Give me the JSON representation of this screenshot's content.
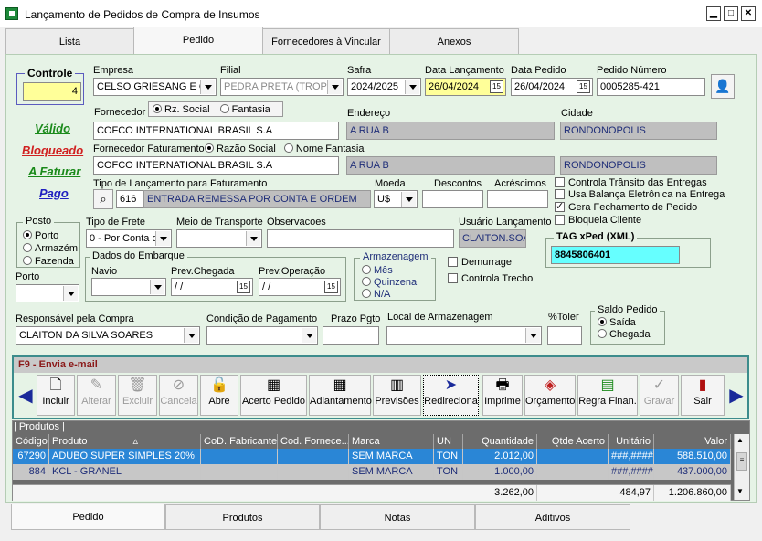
{
  "window": {
    "title": "Lançamento de Pedidos de Compra de Insumos",
    "min": "▁",
    "max": "□",
    "close": "✕"
  },
  "tabs": [
    "Lista",
    "Pedido",
    "Fornecedores à Vincular",
    "Anexos"
  ],
  "controle": {
    "legend": "Controle",
    "value": "4"
  },
  "empresa": {
    "label": "Empresa",
    "value": "CELSO GRIESANG E OU"
  },
  "filial": {
    "label": "Filial",
    "value": "PEDRA PRETA (TROPIC"
  },
  "safra": {
    "label": "Safra",
    "value": "2024/2025"
  },
  "data_lancamento": {
    "label": "Data Lançamento",
    "value": "26/04/2024"
  },
  "data_pedido": {
    "label": "Data Pedido",
    "value": "26/04/2024"
  },
  "pedido_numero": {
    "label": "Pedido Número",
    "value": "0005285-421"
  },
  "status": {
    "valido": "Válido",
    "bloqueado": "Bloqueado",
    "a_faturar": "A Faturar",
    "pago": "Pago"
  },
  "fornecedor": {
    "label": "Fornecedor",
    "opt1": "Rz. Social",
    "opt2": "Fantasia",
    "value": "COFCO INTERNATIONAL BRASIL S.A",
    "endereco_label": "Endereço",
    "endereco": "A RUA B",
    "cidade_label": "Cidade",
    "cidade": "RONDONOPOLIS"
  },
  "fornecedor_fat": {
    "label": "Fornecedor Faturamento",
    "opt1": "Razão Social",
    "opt2": "Nome Fantasia",
    "value": "COFCO INTERNATIONAL BRASIL S.A",
    "endereco": "A RUA B",
    "cidade": "RONDONOPOLIS"
  },
  "tipo_lancamento": {
    "label": "Tipo de Lançamento para Faturamento",
    "code": "616",
    "desc": "ENTRADA REMESSA POR CONTA E ORDEM"
  },
  "moeda": {
    "label": "Moeda",
    "value": "U$"
  },
  "descontos": {
    "label": "Descontos",
    "value": ""
  },
  "acrescimos": {
    "label": "Acréscimos",
    "value": ""
  },
  "checks": [
    "Controla Trânsito das Entregas",
    "Usa Balança Eletrônica na Entrega",
    "Gera Fechamento de Pedido",
    "Bloqueia Cliente"
  ],
  "posto": {
    "legend": "Posto",
    "opts": [
      "Porto",
      "Armazém",
      "Fazenda"
    ],
    "porto_label": "Porto"
  },
  "tipo_frete": {
    "label": "Tipo de Frete",
    "value": "0 - Por Conta d"
  },
  "meio_transporte": {
    "label": "Meio de Transporte",
    "value": ""
  },
  "observacoes": {
    "label": "Observacoes",
    "value": ""
  },
  "usuario": {
    "label": "Usuário Lançamento",
    "value": "CLAITON.SOA"
  },
  "tag": {
    "legend": "TAG xPed (XML)",
    "value": "8845806401"
  },
  "embarque": {
    "legend": "Dados do Embarque",
    "navio": "Navio",
    "prev_chegada": "Prev.Chegada",
    "prev_operacao": "Prev.Operação",
    "date_empty": " / /"
  },
  "armazenagem": {
    "legend": "Armazenagem",
    "opts": [
      "Mês",
      "Quinzena",
      "N/A"
    ]
  },
  "demurrage": "Demurrage",
  "controla_trecho": "Controla Trecho",
  "responsavel": {
    "label": "Responsável pela Compra",
    "value": "CLAITON DA SILVA SOARES"
  },
  "condicao": {
    "label": "Condição de Pagamento",
    "value": ""
  },
  "prazo": {
    "label": "Prazo Pgto",
    "value": ""
  },
  "local_arm": {
    "label": "Local de Armazenagem",
    "value": ""
  },
  "toler": {
    "label": "%Toler",
    "value": ""
  },
  "saldo": {
    "legend": "Saldo Pedido",
    "opts": [
      "Saída",
      "Chegada"
    ]
  },
  "email_bar": "F9 - Envia e-mail",
  "toolbar": [
    {
      "label": "Incluir",
      "icon": "🗋"
    },
    {
      "label": "Alterar",
      "icon": "✎"
    },
    {
      "label": "Excluir",
      "icon": "🗑"
    },
    {
      "label": "Cancela",
      "icon": "⊘"
    },
    {
      "label": "Abre",
      "icon": "🔓"
    },
    {
      "label": "Acerto Pedido",
      "icon": "▦"
    },
    {
      "label": "Adiantamento",
      "icon": "▦"
    },
    {
      "label": "Previsões",
      "icon": "▥"
    },
    {
      "label": "Redireciona",
      "icon": "➤"
    },
    {
      "label": "Imprime",
      "icon": "🖶"
    },
    {
      "label": "Orçamento",
      "icon": "◈"
    },
    {
      "label": "Regra Finan.",
      "icon": "▤"
    },
    {
      "label": "Gravar",
      "icon": "✓"
    },
    {
      "label": "Sair",
      "icon": "▮"
    }
  ],
  "produtos": {
    "legend": "Produtos",
    "headers": [
      "Código",
      "Produto",
      "CoD. Fabricante",
      "Cod. Fornece...",
      "Marca",
      "UN",
      "Quantidade",
      "Qtde Acerto",
      "Unitário",
      "Valor"
    ],
    "rows": [
      [
        "67290",
        "ADUBO SIMPLES 20%",
        "",
        "",
        "SEM MARCA",
        "TON",
        "2.012,00",
        "",
        "###,####",
        "588.510,00"
      ],
      [
        "884",
        "KCL - GRANEL",
        "",
        "",
        "SEM MARCA",
        "TON",
        "1.000,00",
        "",
        "###,####",
        "437.000,00"
      ]
    ],
    "totals": {
      "quantidade": "3.262,00",
      "unitario": "484,97",
      "valor": "1.206.860,00"
    }
  },
  "bottom_tabs": [
    "Pedido",
    "Produtos",
    "Notas",
    "Aditivos"
  ]
}
